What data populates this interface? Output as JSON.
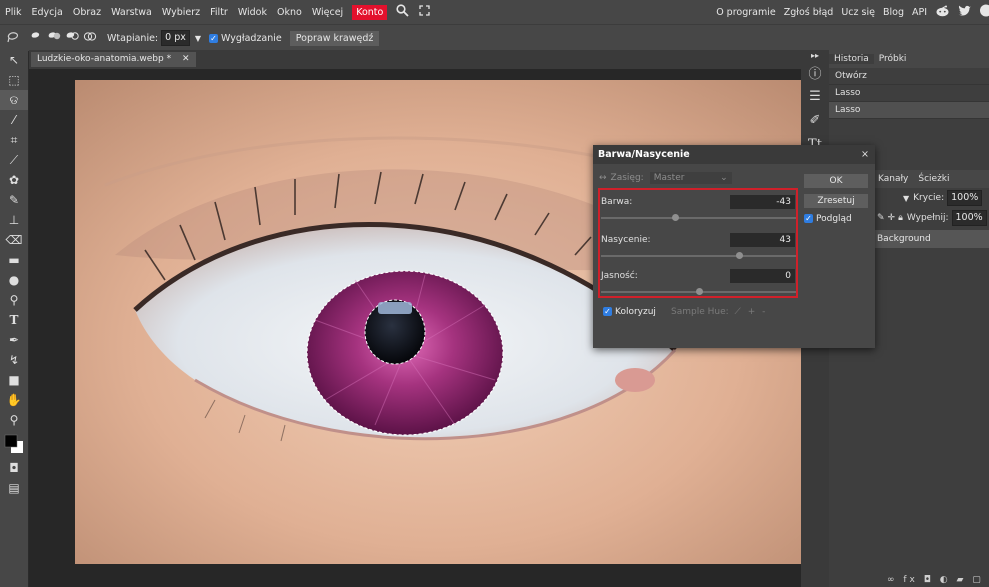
{
  "menubar": {
    "items": [
      "Plik",
      "Edycja",
      "Obraz",
      "Warstwa",
      "Wybierz",
      "Filtr",
      "Widok",
      "Okno",
      "Więcej"
    ],
    "konto": "Konto",
    "right_items": [
      "O programie",
      "Zgłoś błąd",
      "Ucz się",
      "Blog",
      "API"
    ]
  },
  "tool_options": {
    "feather_label": "Wtapianie:",
    "feather_value": "0 px",
    "antialias_label": "Wygładzanie",
    "refine_edge_label": "Popraw krawędź"
  },
  "document_tab": {
    "name": "Ludzkie-oko-anatomia.webp *",
    "close": "✕"
  },
  "history_panel": {
    "tabs": [
      "Historia",
      "Próbki"
    ],
    "items": [
      "Otwórz",
      "Lasso",
      "Lasso"
    ]
  },
  "layers_panel": {
    "tabs": [
      "Kanały",
      "Ścieżki"
    ],
    "opacity_label": "Krycie:",
    "opacity_value": "100%",
    "fill_label": "Wypełnij:",
    "fill_value": "100%",
    "layer_name": "Background"
  },
  "dialog": {
    "title": "Barwa/Nasycenie",
    "close": "×",
    "range_label": "Zasięg:",
    "range_value": "Master",
    "ok_label": "OK",
    "reset_label": "Zresetuj",
    "preview_label": "Podgląd",
    "colorize_label": "Koloryzuj",
    "sample_hue_label": "Sample Hue:",
    "sliders": [
      {
        "label": "Barwa:",
        "value": "-43",
        "position": 0.38
      },
      {
        "label": "Nasycenie:",
        "value": "43",
        "position": 0.71
      },
      {
        "label": "Jasność:",
        "value": "0",
        "position": 0.5
      }
    ]
  },
  "colors": {
    "accent": "#2f7de1",
    "konto_red": "#e3112d",
    "highlight_box": "#d0202a",
    "iris": "#a5337f"
  }
}
